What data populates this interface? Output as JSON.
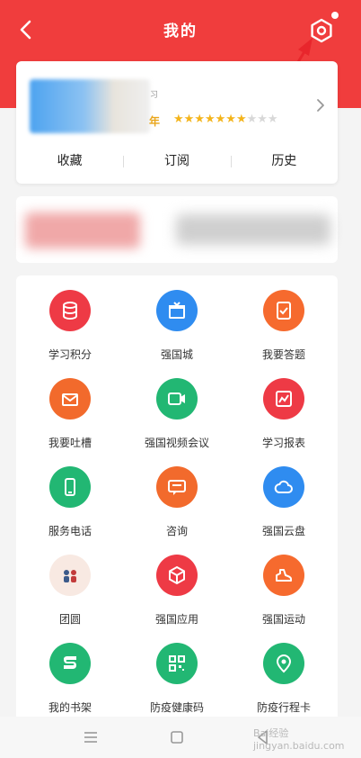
{
  "header": {
    "title": "我的"
  },
  "profile": {
    "year_suffix": "年",
    "small_mark": "习",
    "stars_on": 7,
    "stars_total": 10
  },
  "quick_tabs": [
    "收藏",
    "订阅",
    "历史"
  ],
  "grid": [
    {
      "label": "学习积分",
      "icon": "database-icon",
      "color": "#ee3a45"
    },
    {
      "label": "强国城",
      "icon": "gift-icon",
      "color": "#2f8cf0"
    },
    {
      "label": "我要答题",
      "icon": "answer-icon",
      "color": "#f66a2e"
    },
    {
      "label": "我要吐槽",
      "icon": "mail-icon",
      "color": "#f26a2c"
    },
    {
      "label": "强国视频会议",
      "icon": "video-icon",
      "color": "#22b773"
    },
    {
      "label": "学习报表",
      "icon": "report-icon",
      "color": "#ee3a45"
    },
    {
      "label": "服务电话",
      "icon": "phone-icon",
      "color": "#22b773"
    },
    {
      "label": "咨询",
      "icon": "chat-icon",
      "color": "#f26a2c"
    },
    {
      "label": "强国云盘",
      "icon": "cloud-icon",
      "color": "#2f8cf0"
    },
    {
      "label": "团圆",
      "icon": "reunion-icon",
      "color": "#f8e9e2"
    },
    {
      "label": "强国应用",
      "icon": "cube-icon",
      "color": "#ee3a45"
    },
    {
      "label": "强国运动",
      "icon": "shoe-icon",
      "color": "#f66a2e"
    },
    {
      "label": "我的书架",
      "icon": "bookshelf-icon",
      "color": "#22b773"
    },
    {
      "label": "防疫健康码",
      "icon": "qrcode-icon",
      "color": "#22b773"
    },
    {
      "label": "防疫行程卡",
      "icon": "location-icon",
      "color": "#22b773"
    }
  ],
  "watermark": "Bai经验 jingyan.baidu.com"
}
